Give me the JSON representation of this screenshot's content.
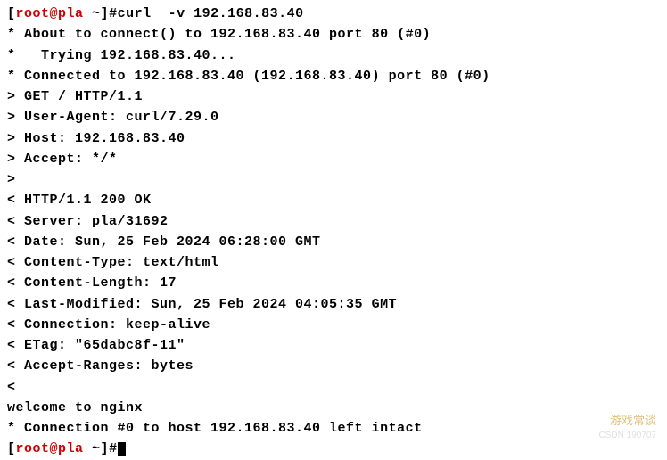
{
  "prompt": {
    "open_bracket": "[",
    "user_host": "root@pla",
    "path": " ~",
    "close_bracket": "]",
    "symbol": "#"
  },
  "command": "curl  -v 192.168.83.40",
  "output": {
    "lines": [
      "* About to connect() to 192.168.83.40 port 80 (#0)",
      "*   Trying 192.168.83.40...",
      "* Connected to 192.168.83.40 (192.168.83.40) port 80 (#0)",
      "> GET / HTTP/1.1",
      "> User-Agent: curl/7.29.0",
      "> Host: 192.168.83.40",
      "> Accept: */*",
      ">",
      "< HTTP/1.1 200 OK",
      "< Server: pla/31692",
      "< Date: Sun, 25 Feb 2024 06:28:00 GMT",
      "< Content-Type: text/html",
      "< Content-Length: 17",
      "< Last-Modified: Sun, 25 Feb 2024 04:05:35 GMT",
      "< Connection: keep-alive",
      "< ETag: \"65dabc8f-11\"",
      "< Accept-Ranges: bytes",
      "<",
      "welcome to nginx",
      "* Connection #0 to host 192.168.83.40 left intact"
    ]
  },
  "watermark": {
    "main": "游戏常谈",
    "sub": "CSDN 190707"
  }
}
